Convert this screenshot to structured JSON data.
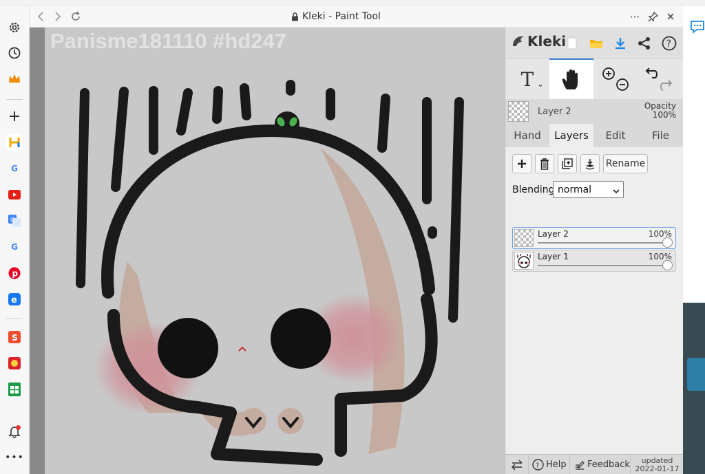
{
  "window": {
    "title": "Kleki - Paint Tool"
  },
  "canvas": {
    "watermark": "Panisme181110 #hd247"
  },
  "app": {
    "logo_text": "Kleki"
  },
  "layer_info": {
    "name": "Layer 2",
    "opacity_label": "Opacity",
    "opacity_value": "100%"
  },
  "tabs": [
    {
      "label": "Hand"
    },
    {
      "label": "Layers"
    },
    {
      "label": "Edit"
    },
    {
      "label": "File"
    }
  ],
  "layers_panel": {
    "rename_label": "Rename",
    "blending_label": "Blending",
    "blending_value": "normal",
    "layers": [
      {
        "name": "Layer 2",
        "opacity": "100%",
        "opacity_fraction": 1.0
      },
      {
        "name": "Layer 1",
        "opacity": "100%",
        "opacity_fraction": 1.0
      }
    ]
  },
  "bottom": {
    "help_label": "Help",
    "feedback_label": "Feedback",
    "updated_label": "updated",
    "updated_date": "2022-01-17"
  },
  "colors": {
    "accent": "#3e7fd6",
    "panel_bg": "#d9d9d9",
    "canvas_bg": "#c8c8c8"
  }
}
